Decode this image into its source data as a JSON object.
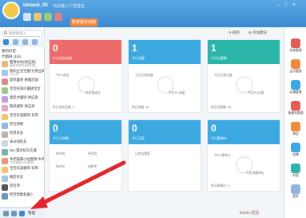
{
  "user": {
    "name": "Ishaenl_00",
    "signature": "点此输入个性签名"
  },
  "header": {
    "version_button": "新老版本切换"
  },
  "sidebar": {
    "search_placeholder": "搜索联系人",
    "groups": [
      {
        "label": "我的好友",
        "count": ""
      },
      {
        "label": "代销商 (1/5)",
        "count": ""
      }
    ],
    "contacts": [
      {
        "name": "蜜贵吵吵(供应商)",
        "msg": "蜜贵吵吵吵(供应商)"
      },
      {
        "name": "颜如玉宝宝蜜汁(供应商)",
        "msg": "可以吗"
      },
      {
        "name": "禁笑蕾英·韩蜜店铺",
        "msg": ""
      },
      {
        "name": "宝宝校花仔蜜桃宝宝",
        "msg": ""
      },
      {
        "name": "奥凯文服饰·供应商",
        "msg": ""
      },
      {
        "name": "韩风服饰·供应商",
        "msg": ""
      },
      {
        "name": "宝宝彩美服饰·衣库",
        "msg": ""
      },
      {
        "name": "阿宝购物",
        "msg": ""
      },
      {
        "name": "阿里好友",
        "msg": ""
      },
      {
        "name": "未分组好友",
        "msg": ""
      },
      {
        "name": "lion·遇冰码头先锋",
        "msg": ""
      },
      {
        "name": "牛奶猫萌小拉图饰·牛奇",
        "msg": "牛奶猫萌小拉图饰"
      },
      {
        "name": "宝宝彩美服饰·衣库",
        "msg": ""
      },
      {
        "name": "网店好友",
        "msg": ""
      },
      {
        "name": "黑名单",
        "msg": ""
      },
      {
        "name": "阿宝智能机器人",
        "msg": ""
      }
    ],
    "groups_lower": [
      "未分组好友 (1/5)",
      "网店好友 (1)",
      "黑名单 (1)"
    ],
    "bottom_label": "管理"
  },
  "toolbar": {
    "refresh": "刷新",
    "add_module": "添加模块"
  },
  "cards_top": [
    {
      "number": "0",
      "subtitle": "今日成交金额",
      "color": "#ee6b6b",
      "metrics": [
        "今PC成交",
        "今无线成交"
      ],
      "foot": "昨日成交金额: 0"
    },
    {
      "number": "1",
      "subtitle": "今日流量",
      "color": "#3ba8e0",
      "metrics": [
        "今日无线流量",
        "今日PC流量"
      ],
      "foot": "昨日流量: 56"
    },
    {
      "number": "1",
      "subtitle": "今日访客数",
      "color": "#2bb5a8",
      "metrics": [
        "今日无线访客",
        "今日PC访客"
      ],
      "foot": "昨日访客数: 56"
    }
  ],
  "cards_bottom": [
    {
      "number": "0",
      "subtitle": "今日订单数",
      "color": "#3ba8e0",
      "cells": [
        "待付款",
        "待发货",
        "待评价",
        "退款中"
      ]
    },
    {
      "number": "0",
      "subtitle": "今日买家",
      "color": "#3ba8e0",
      "cells": [
        "已卖宝推荐"
      ]
    },
    {
      "number": "0",
      "subtitle": "今日客单价",
      "color": "#3ba8e0",
      "metrics": [
        "今PC客单价",
        "今无线客单价"
      ],
      "foot": "昨日客单价: 0"
    }
  ],
  "right_panel": [
    "交易管理",
    "宝贝管理",
    "店铺管理",
    "直通车管理",
    "淘宝",
    "店铺",
    "阿里",
    "更多"
  ],
  "watermark": "Baidu 经验"
}
